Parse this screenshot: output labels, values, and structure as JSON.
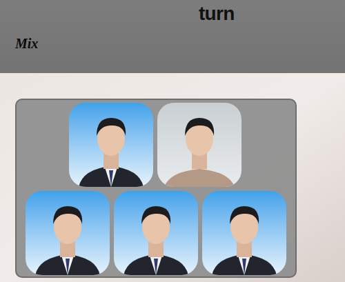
{
  "logo": "turn",
  "title": "Mix"
}
